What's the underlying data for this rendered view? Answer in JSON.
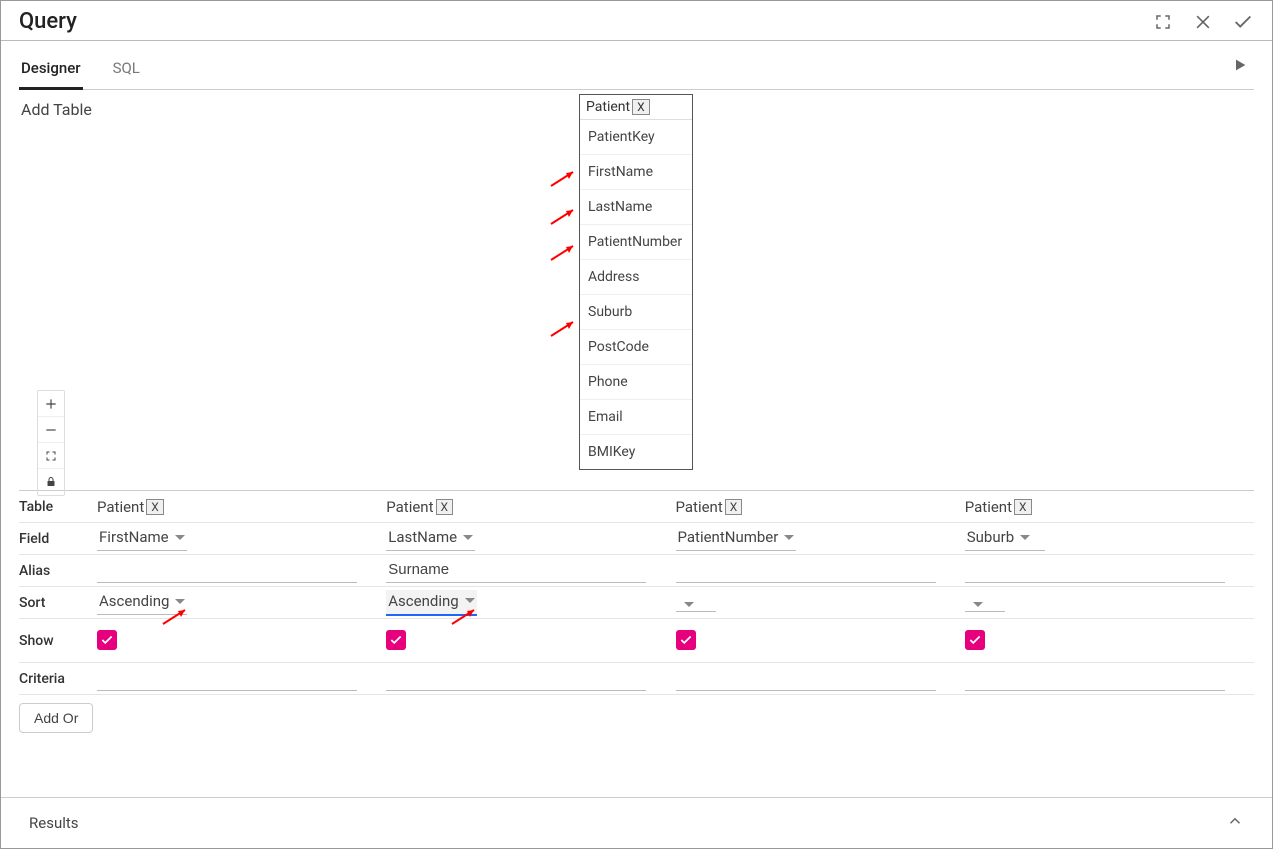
{
  "window": {
    "title": "Query"
  },
  "tabs": {
    "designer": "Designer",
    "sql": "SQL"
  },
  "addTable": "Add Table",
  "tableCard": {
    "name": "Patient",
    "close": "X",
    "fields": [
      "PatientKey",
      "FirstName",
      "LastName",
      "PatientNumber",
      "Address",
      "Suburb",
      "PostCode",
      "Phone",
      "Email",
      "BMIKey"
    ]
  },
  "grid": {
    "labels": {
      "table": "Table",
      "field": "Field",
      "alias": "Alias",
      "sort": "Sort",
      "show": "Show",
      "criteria": "Criteria"
    },
    "addOr": "Add Or",
    "cols": [
      {
        "table": "Patient",
        "field": "FirstName",
        "alias": "",
        "sort": "Ascending",
        "show": true
      },
      {
        "table": "Patient",
        "field": "LastName",
        "alias": "Surname",
        "sort": "Ascending",
        "show": true
      },
      {
        "table": "Patient",
        "field": "PatientNumber",
        "alias": "",
        "sort": "",
        "show": true
      },
      {
        "table": "Patient",
        "field": "Suburb",
        "alias": "",
        "sort": "",
        "show": true
      }
    ],
    "chipClose": "X"
  },
  "results": {
    "label": "Results"
  }
}
